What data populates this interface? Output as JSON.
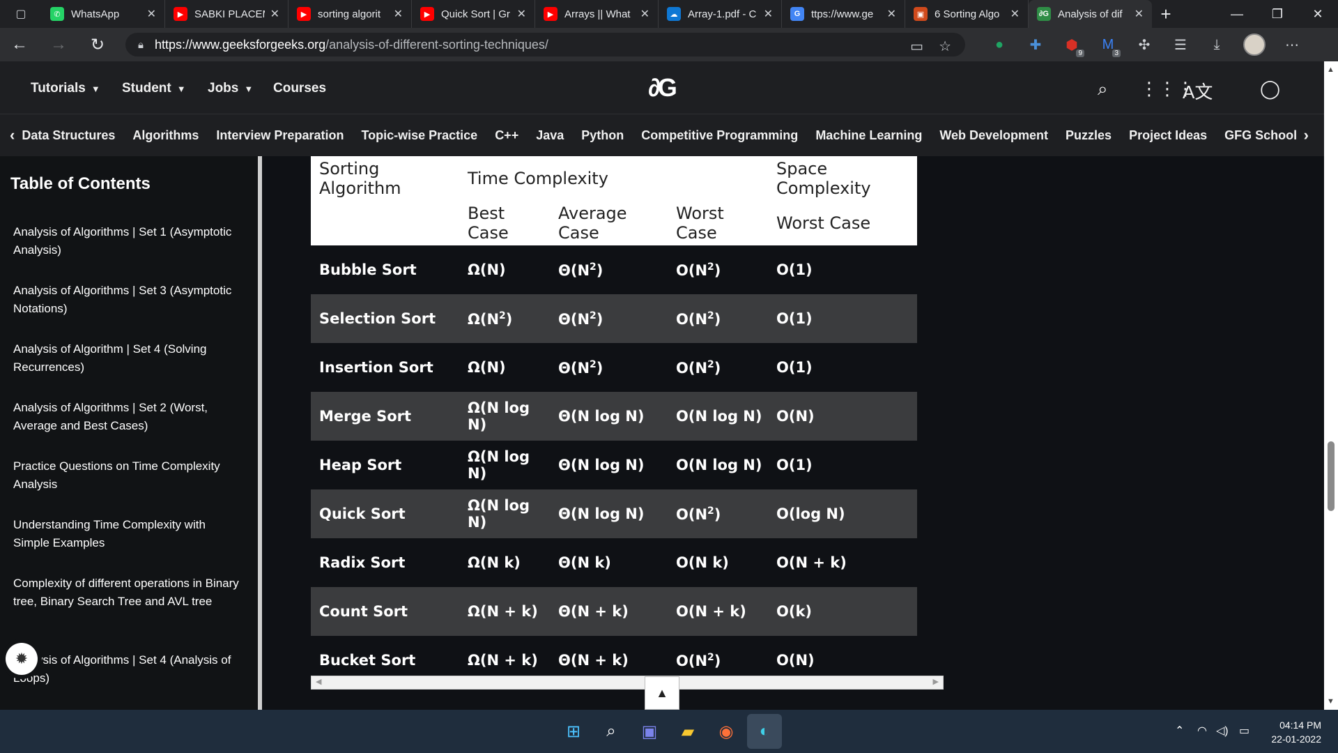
{
  "browser": {
    "tabs": [
      {
        "title": "WhatsApp",
        "color": "#25d366",
        "glyph": "✆"
      },
      {
        "title": "SABKI PLACEM",
        "color": "#ff0000",
        "glyph": "▶"
      },
      {
        "title": "sorting algorit",
        "color": "#ff0000",
        "glyph": "▶"
      },
      {
        "title": "Quick Sort | Gr",
        "color": "#ff0000",
        "glyph": "▶"
      },
      {
        "title": "Arrays || What",
        "color": "#ff0000",
        "glyph": "▶"
      },
      {
        "title": "Array-1.pdf - C",
        "color": "#0f78d4",
        "glyph": "☁"
      },
      {
        "title": "ttps://www.ge",
        "color": "#4285f4",
        "glyph": "G"
      },
      {
        "title": "6 Sorting Algo",
        "color": "#d04a1c",
        "glyph": "▣"
      },
      {
        "title": "Analysis of dif",
        "color": "#2f8d46",
        "glyph": "∂G"
      }
    ],
    "url_host": "https://www.geeksforgeeks.org",
    "url_path": "/analysis-of-different-sorting-techniques/",
    "ext_badges": [
      "9",
      "3"
    ]
  },
  "header": {
    "menu": [
      "Tutorials",
      "Student",
      "Jobs",
      "Courses"
    ],
    "logo": "∂G"
  },
  "subnav": [
    "Data Structures",
    "Algorithms",
    "Interview Preparation",
    "Topic-wise Practice",
    "C++",
    "Java",
    "Python",
    "Competitive Programming",
    "Machine Learning",
    "Web Development",
    "Puzzles",
    "Project Ideas",
    "GFG School"
  ],
  "sidebar": {
    "title": "Table of Contents",
    "items": [
      "Analysis of Algorithms | Set 1 (Asymptotic Analysis)",
      "Analysis of Algorithms | Set 3 (Asymptotic Notations)",
      "Analysis of Algorithm | Set 4 (Solving Recurrences)",
      "Analysis of Algorithms | Set 2 (Worst, Average and Best Cases)",
      "Practice Questions on Time Complexity Analysis",
      "Understanding Time Complexity with Simple Examples",
      "Complexity of different operations in Binary tree, Binary Search Tree and AVL tree",
      "Analysis of Algorithms | Set 4 (Analysis of Loops)"
    ]
  },
  "table": {
    "h1": [
      "Sorting Algorithm",
      "Time Complexity",
      "Space Complexity"
    ],
    "h2": [
      "Best Case",
      "Average Case",
      "Worst Case",
      "Worst Case"
    ],
    "rows": [
      {
        "name": "Bubble Sort",
        "best": "Ω(N)",
        "avg": "Θ(N",
        "avg_sup": "2",
        "avg_end": ")",
        "worst": "O(N",
        "worst_sup": "2",
        "worst_end": ")",
        "space": "O(1)"
      },
      {
        "name": "Selection Sort",
        "best": "Ω(N",
        "best_sup": "2",
        "best_end": ")",
        "avg": "Θ(N",
        "avg_sup": "2",
        "avg_end": ")",
        "worst": "O(N",
        "worst_sup": "2",
        "worst_end": ")",
        "space": "O(1)"
      },
      {
        "name": "Insertion Sort",
        "best": "Ω(N)",
        "avg": "Θ(N",
        "avg_sup": "2",
        "avg_end": ")",
        "worst": "O(N",
        "worst_sup": "2",
        "worst_end": ")",
        "space": "O(1)"
      },
      {
        "name": "Merge Sort",
        "best": "Ω(N log N)",
        "avg": "Θ(N log N)",
        "worst": "O(N log N)",
        "space": "O(N)"
      },
      {
        "name": "Heap Sort",
        "best": "Ω(N log N)",
        "avg": "Θ(N log N)",
        "worst": "O(N log N)",
        "space": "O(1)"
      },
      {
        "name": "Quick Sort",
        "best": "Ω(N log N)",
        "avg": "Θ(N log N)",
        "worst": "O(N",
        "worst_sup": "2",
        "worst_end": ")",
        "space": "O(log N)"
      },
      {
        "name": "Radix Sort",
        "best": "Ω(N k)",
        "avg": "Θ(N k)",
        "worst": "O(N k)",
        "space": "O(N + k)"
      },
      {
        "name": "Count Sort",
        "best": "Ω(N + k)",
        "avg": "Θ(N + k)",
        "worst": "O(N + k)",
        "space": "O(k)"
      },
      {
        "name": "Bucket Sort",
        "best": "Ω(N + k)",
        "avg": "Θ(N + k)",
        "worst": "O(N",
        "worst_sup": "2",
        "worst_end": ")",
        "space": "O(N)"
      }
    ]
  },
  "taskbar": {
    "time": "04:14 PM",
    "date": "22-01-2022"
  }
}
